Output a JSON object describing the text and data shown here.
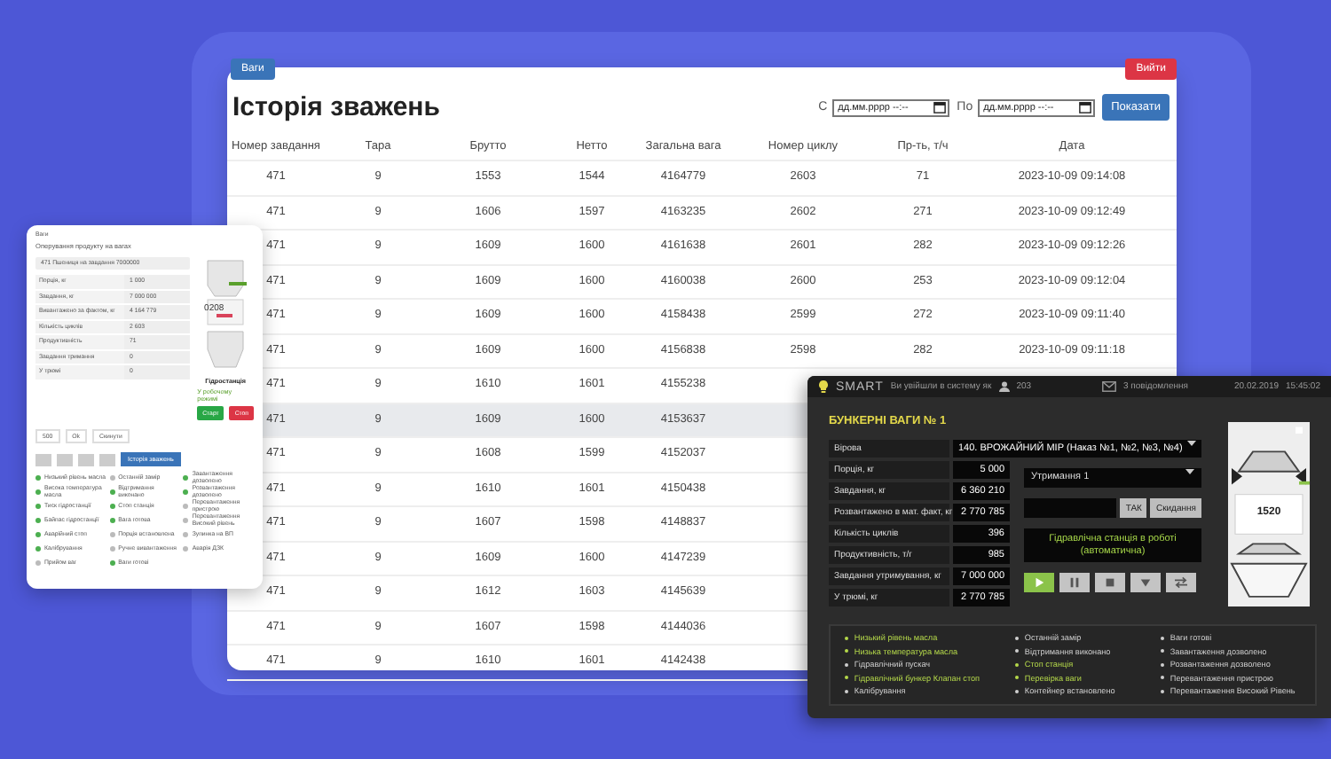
{
  "history": {
    "nav_button": "Ваги",
    "logout_button": "Вийти",
    "title": "Історія зважень",
    "from": {
      "label": "С",
      "placeholder": "дд.мм.рррр --:--"
    },
    "to": {
      "label": "По",
      "placeholder": "дд.мм.рррр --:--"
    },
    "show_button": "Показати",
    "columns": [
      "Номер завдання",
      "Тара",
      "Брутто",
      "Нетто",
      "Загальна вага",
      "Номер циклу",
      "Пр-ть, т/ч",
      "Дата"
    ],
    "rows": [
      {
        "highlighted": false,
        "cells": [
          "471",
          "9",
          "1553",
          "1544",
          "4164779",
          "2603",
          "71",
          "2023-10-09 09:14:08"
        ]
      },
      {
        "highlighted": false,
        "cells": [
          "471",
          "9",
          "1606",
          "1597",
          "4163235",
          "2602",
          "271",
          "2023-10-09 09:12:49"
        ]
      },
      {
        "highlighted": false,
        "cells": [
          "471",
          "9",
          "1609",
          "1600",
          "4161638",
          "2601",
          "282",
          "2023-10-09 09:12:26"
        ]
      },
      {
        "highlighted": false,
        "cells": [
          "471",
          "9",
          "1609",
          "1600",
          "4160038",
          "2600",
          "253",
          "2023-10-09 09:12:04"
        ]
      },
      {
        "highlighted": false,
        "cells": [
          "471",
          "9",
          "1609",
          "1600",
          "4158438",
          "2599",
          "272",
          "2023-10-09 09:11:40"
        ]
      },
      {
        "highlighted": false,
        "cells": [
          "471",
          "9",
          "1609",
          "1600",
          "4156838",
          "2598",
          "282",
          "2023-10-09 09:11:18"
        ]
      },
      {
        "highlighted": false,
        "cells": [
          "471",
          "9",
          "1610",
          "1601",
          "4155238"
        ]
      },
      {
        "highlighted": true,
        "cells": [
          "471",
          "9",
          "1609",
          "1600",
          "4153637"
        ]
      },
      {
        "highlighted": false,
        "cells": [
          "471",
          "9",
          "1608",
          "1599",
          "4152037"
        ]
      },
      {
        "highlighted": false,
        "cells": [
          "471",
          "9",
          "1610",
          "1601",
          "4150438"
        ]
      },
      {
        "highlighted": false,
        "cells": [
          "471",
          "9",
          "1607",
          "1598",
          "4148837"
        ]
      },
      {
        "highlighted": false,
        "cells": [
          "471",
          "9",
          "1609",
          "1600",
          "4147239"
        ]
      },
      {
        "highlighted": false,
        "cells": [
          "471",
          "9",
          "1612",
          "1603",
          "4145639"
        ]
      },
      {
        "highlighted": false,
        "cells": [
          "471",
          "9",
          "1607",
          "1598",
          "4144036"
        ]
      },
      {
        "highlighted": false,
        "cells": [
          "471",
          "9",
          "1610",
          "1601",
          "4142438"
        ]
      }
    ]
  },
  "mini_panel": {
    "header": "Ваги",
    "title": "Оперування продукту на вагах",
    "select": "471 Пшениця на завдання 7000000",
    "fields": [
      {
        "label": "Порція, кг",
        "value": "1 000"
      },
      {
        "label": "Завдання, кг",
        "value": "7 000 000"
      },
      {
        "label": "Вивантажено за фактом, кг",
        "value": "4 164 779"
      },
      {
        "label": "Кількість циклів",
        "value": "2 603"
      },
      {
        "label": "Продуктивність",
        "value": "71"
      },
      {
        "label": "Завдання тримання",
        "value": "0"
      },
      {
        "label": "У трюмі",
        "value": "0"
      }
    ],
    "hopper_reading": "0208",
    "station_label": "Гідростанція",
    "station_state": "У робочому режимі",
    "start_button": "Старт",
    "stop_button": "Стоп",
    "amount": "500",
    "ok_button": "Ok",
    "reset_button": "Скинути",
    "history_button": "Історія зважень",
    "status": [
      {
        "label": "Низький рівень масла",
        "active": true
      },
      {
        "label": "Висока температура масла",
        "active": true
      },
      {
        "label": "Тиск гідростанції",
        "active": true
      },
      {
        "label": "Байпас гідростанції",
        "active": true
      },
      {
        "label": "Аварійний стоп",
        "active": true
      },
      {
        "label": "Калібрування",
        "active": true
      },
      {
        "label": "Прийом ваг",
        "active": false
      },
      {
        "label": "Останній замір",
        "active": false
      },
      {
        "label": "Відтримання виконано",
        "active": true
      },
      {
        "label": "Стоп станція",
        "active": true
      },
      {
        "label": "Вага готова",
        "active": true
      },
      {
        "label": "Порція встановлена",
        "active": false
      },
      {
        "label": "Ручне вивантаження",
        "active": false
      },
      {
        "label": "Ваги готові",
        "active": true
      },
      {
        "label": "Завантаження дозволено",
        "active": true
      },
      {
        "label": "Розвантаження дозволено",
        "active": true
      },
      {
        "label": "Перевантаження пристрою",
        "active": false
      },
      {
        "label": "Перевантаження Високий рівень",
        "active": false
      },
      {
        "label": "Зупинка на ВП",
        "active": false
      },
      {
        "label": "Аварія ДЗК",
        "active": false
      }
    ]
  },
  "smart": {
    "logo": "SMART",
    "login_text": "Ви увійшли в систему як",
    "user": "203",
    "messages": "3 повідомлення",
    "date": "20.02.2019",
    "time": "15:45:02",
    "title": "БУНКЕРНІ ВАГИ № 1",
    "product": {
      "label": "Вірова",
      "value": "140. ВРОЖАЙНИЙ МІР (Наказ №1, №2, №3, №4)"
    },
    "fields": [
      {
        "label": "Порція, кг",
        "value": "5 000"
      },
      {
        "label": "Завдання, кг",
        "value": "6 360 210"
      },
      {
        "label": "Розвантажено в мат. факт, кг",
        "value": "2 770 785"
      },
      {
        "label": "Кількість циклів",
        "value": "396"
      },
      {
        "label": "Продуктивність, т/г",
        "value": "985"
      },
      {
        "label": "Завдання утримування, кг",
        "value": "7 000 000"
      },
      {
        "label": "У трюмі, кг",
        "value": "2 770 785"
      }
    ],
    "mode_select": "Утримання 1",
    "confirm_button": "ТАК",
    "reset_button": "Скидання",
    "station_status": "Гідравлічна станція в роботі (автоматична)",
    "controls": [
      {
        "kind": "play",
        "active": true
      },
      {
        "kind": "pause",
        "active": false
      },
      {
        "kind": "stop",
        "active": false
      },
      {
        "kind": "down",
        "active": false
      },
      {
        "kind": "swap",
        "active": false
      }
    ],
    "hopper_reading": "1520",
    "status": [
      {
        "label": "Низький рівень масла",
        "active": true
      },
      {
        "label": "Низька температура масла",
        "active": true
      },
      {
        "label": "Гідравлічний пускач",
        "active": false
      },
      {
        "label": "Гідравлічний бункер Клапан стоп",
        "active": true
      },
      {
        "label": "Калібрування",
        "active": false
      },
      {
        "label": "Останній замір",
        "active": false
      },
      {
        "label": "Відтримання виконано",
        "active": false
      },
      {
        "label": "Стоп станція",
        "active": true
      },
      {
        "label": "Перевірка ваги",
        "active": true
      },
      {
        "label": "Контейнер встановлено",
        "active": false
      },
      {
        "label": "Ваги готові",
        "active": false
      },
      {
        "label": "Завантаження дозволено",
        "active": false
      },
      {
        "label": "Розвантаження дозволено",
        "active": false
      },
      {
        "label": "Перевантаження пристрою",
        "active": false
      },
      {
        "label": "Перевантаження Високий Рівень",
        "active": false
      }
    ]
  }
}
